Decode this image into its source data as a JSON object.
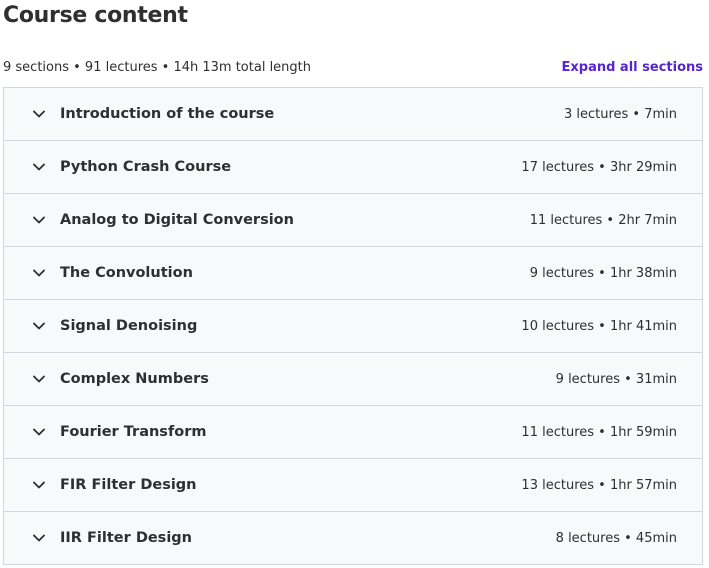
{
  "header": {
    "title": "Course content",
    "summary": "9 sections • 91 lectures • 14h 13m total length",
    "expand_all_label": "Expand all sections"
  },
  "colors": {
    "accent": "#5624d0",
    "text": "#2d2f31",
    "section_bg": "#f7f9fa",
    "border": "#d1d7dc"
  },
  "sections": [
    {
      "title": "Introduction of the course",
      "meta": "3 lectures • 7min",
      "icon": "chevron-down-icon"
    },
    {
      "title": "Python Crash Course",
      "meta": "17 lectures • 3hr 29min",
      "icon": "chevron-down-icon"
    },
    {
      "title": "Analog to Digital Conversion",
      "meta": "11 lectures • 2hr 7min",
      "icon": "chevron-down-icon"
    },
    {
      "title": "The Convolution",
      "meta": "9 lectures • 1hr 38min",
      "icon": "chevron-down-icon"
    },
    {
      "title": "Signal Denoising",
      "meta": "10 lectures • 1hr 41min",
      "icon": "chevron-down-icon"
    },
    {
      "title": "Complex Numbers",
      "meta": "9 lectures • 31min",
      "icon": "chevron-down-icon"
    },
    {
      "title": "Fourier Transform",
      "meta": "11 lectures • 1hr 59min",
      "icon": "chevron-down-icon"
    },
    {
      "title": "FIR Filter Design",
      "meta": "13 lectures • 1hr 57min",
      "icon": "chevron-down-icon"
    },
    {
      "title": "IIR Filter Design",
      "meta": "8 lectures • 45min",
      "icon": "chevron-down-icon"
    }
  ]
}
